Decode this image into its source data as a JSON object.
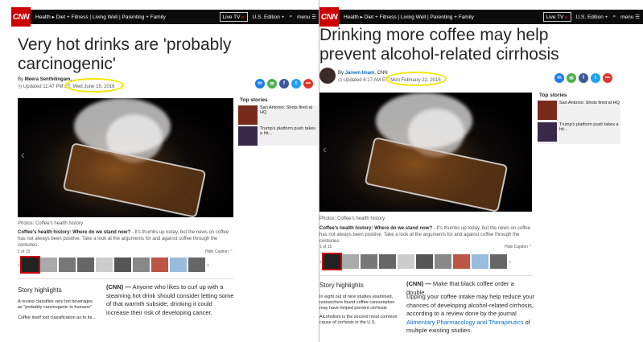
{
  "nav": {
    "logo": "CNN",
    "links": "Health ▸ Diet + Fitness | Living Well | Parenting + Family",
    "live_tv": "Live TV",
    "edition": "U.S. Edition +",
    "menu": "menu"
  },
  "left": {
    "headline": "Very hot drinks are 'probably carcinogenic'",
    "by": "By",
    "author": "Meera Senthilingam, ...",
    "updated": "Updated 11:47 PM ET,",
    "date": "Wed June 15, 2016",
    "photos_label": "Photos: Coffee's health history",
    "caption_lead": "Coffee's health history: Where do we stand now?",
    "caption_text": " - It's thumbs up today, but the news on coffee has not always been positive. Take a look at the arguments for and against coffee through the centuries.",
    "counter": "1 of 15",
    "hide_caption": "Hide Caption",
    "top_stories": "Top stories",
    "story1": "San Antonio: Shots fired at HQ",
    "story2": "Trump's platform push takes a hit...",
    "highlights_title": "Story highlights",
    "highlight1": "A review classifies very hot beverages as \"probably carcinogenic to humans\"",
    "highlight2": "Coffee itself lost classification as to its...",
    "body_lead": "(CNN) —",
    "body_text": " Anyone who likes to curl up with a steaming hot drink should consider letting some of that warmth subside; drinking it could increase their risk of developing cancer."
  },
  "right": {
    "headline": "Drinking more coffee may help prevent alcohol-related cirrhosis",
    "by": "By",
    "author": "Jareen Imam",
    "outlet": ", CNN",
    "updated": "Updated 6:17 AM ET,",
    "date": "Mon February 22, 2016",
    "photos_label": "Photos: Coffee's health history",
    "caption_lead": "Coffee's health history: Where do we stand now?",
    "caption_text": " - It's thumbs up today, but the news on coffee has not always been positive. Take a look at the arguments for and against coffee through the centuries.",
    "counter": "1 of 15",
    "hide_caption": "Hide Caption",
    "top_stories": "Top stories",
    "story1": "San Antonio: Shots fired at HQ",
    "story2": "Trump's platform push takes a hit...",
    "highlights_title": "Story highlights",
    "highlight1": "In eight out of nine studies examined, researchers found coffee consumption may have helped prevent cirrhosis",
    "highlight2": "Alcoholism is the second most common cause of cirrhosis in the U.S.",
    "body_lead": "(CNN) —",
    "body_p1": " Make that black coffee order a double.",
    "body_p2a": "Upping your coffee intake may help reduce your chances of developing alcohol-related cirrhosis, according to a review done by the journal ",
    "body_link": "Alimentary Pharmacology and Therapeutics",
    "body_p2b": " of multiple existing studies."
  },
  "colors": {
    "cnn_red": "#cc0000",
    "highlight_ellipse": "#f5e400",
    "link_blue": "#0c6bcb"
  },
  "icons": [
    "messenger-icon",
    "email-icon",
    "facebook-icon",
    "twitter-icon",
    "more-icon",
    "search-icon",
    "hamburger-icon",
    "chevron-left-icon",
    "chevron-right-icon"
  ]
}
